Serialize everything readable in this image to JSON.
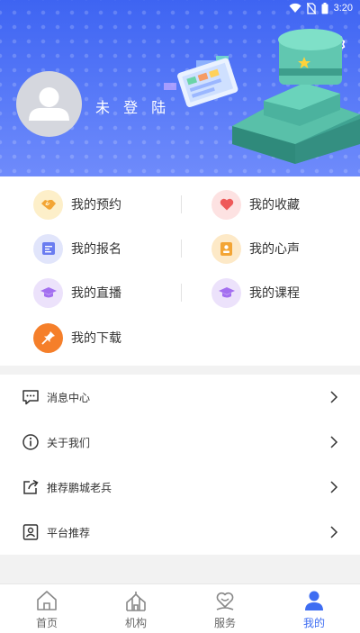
{
  "status": {
    "time": "3:20"
  },
  "header": {
    "login_text": "未 登 陆"
  },
  "features": [
    {
      "label": "我的预约",
      "icon": "handshake-icon",
      "bg": "#fdefc9",
      "color": "#f3a535"
    },
    {
      "label": "我的收藏",
      "icon": "heart-icon",
      "bg": "#fde2e2",
      "color": "#ee5a5a"
    },
    {
      "label": "我的报名",
      "icon": "form-icon",
      "bg": "#e1e5fb",
      "color": "#6a7cf0"
    },
    {
      "label": "我的心声",
      "icon": "contact-card-icon",
      "bg": "#fde9c7",
      "color": "#f3a535"
    },
    {
      "label": "我的直播",
      "icon": "graduation-cap-icon",
      "bg": "#ece2fb",
      "color": "#a36ff0"
    },
    {
      "label": "我的课程",
      "icon": "graduation-cap-icon",
      "bg": "#ece2fb",
      "color": "#a36ff0"
    },
    {
      "label": "我的下载",
      "icon": "pin-icon",
      "bg": "#f57f2a",
      "color": "#ffffff"
    }
  ],
  "menu": [
    {
      "label": "消息中心",
      "icon": "message-icon"
    },
    {
      "label": "关于我们",
      "icon": "info-icon"
    },
    {
      "label": "推荐鹏城老兵",
      "icon": "share-icon"
    },
    {
      "label": "平台推荐",
      "icon": "user-card-icon"
    }
  ],
  "nav": [
    {
      "label": "首页",
      "icon": "home-icon",
      "active": false
    },
    {
      "label": "机构",
      "icon": "building-icon",
      "active": false
    },
    {
      "label": "服务",
      "icon": "service-heart-icon",
      "active": false
    },
    {
      "label": "我的",
      "icon": "person-icon",
      "active": true
    }
  ],
  "colors": {
    "primary": "#3e6df2",
    "header_top": "#3e64f2",
    "header_bottom": "#6f8bfb"
  }
}
